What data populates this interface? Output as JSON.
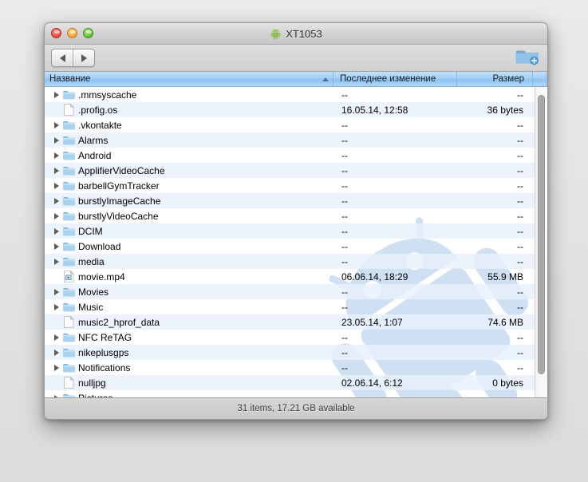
{
  "window": {
    "title": "XT1053",
    "title_icon": "android-robot-icon",
    "controls": {
      "close": "close-button",
      "minimize": "minimize-button",
      "maximize": "maximize-button"
    }
  },
  "toolbar": {
    "back_icon": "triangle-left-icon",
    "forward_icon": "triangle-right-icon",
    "new_folder_icon": "new-folder-icon"
  },
  "columns": {
    "name": "Название",
    "date": "Последнее изменение",
    "size": "Размер",
    "sort_indicator": "sort-ascending-arrow"
  },
  "files": [
    {
      "name": ".mmsyscache",
      "date": "--",
      "size": "--",
      "type": "folder"
    },
    {
      "name": ".profig.os",
      "date": "16.05.14, 12:58",
      "size": "36 bytes",
      "type": "file"
    },
    {
      "name": ".vkontakte",
      "date": "--",
      "size": "--",
      "type": "folder"
    },
    {
      "name": "Alarms",
      "date": "--",
      "size": "--",
      "type": "folder"
    },
    {
      "name": "Android",
      "date": "--",
      "size": "--",
      "type": "folder"
    },
    {
      "name": "ApplifierVideoCache",
      "date": "--",
      "size": "--",
      "type": "folder"
    },
    {
      "name": "barbellGymTracker",
      "date": "--",
      "size": "--",
      "type": "folder"
    },
    {
      "name": "burstlyImageCache",
      "date": "--",
      "size": "--",
      "type": "folder"
    },
    {
      "name": "burstlyVideoCache",
      "date": "--",
      "size": "--",
      "type": "folder"
    },
    {
      "name": "DCIM",
      "date": "--",
      "size": "--",
      "type": "folder"
    },
    {
      "name": "Download",
      "date": "--",
      "size": "--",
      "type": "folder"
    },
    {
      "name": "media",
      "date": "--",
      "size": "--",
      "type": "folder"
    },
    {
      "name": "movie.mp4",
      "date": "06.06.14, 18:29",
      "size": "55.9 MB",
      "type": "media"
    },
    {
      "name": "Movies",
      "date": "--",
      "size": "--",
      "type": "folder"
    },
    {
      "name": "Music",
      "date": "--",
      "size": "--",
      "type": "folder"
    },
    {
      "name": "music2_hprof_data",
      "date": "23.05.14, 1:07",
      "size": "74.6 MB",
      "type": "file"
    },
    {
      "name": "NFC ReTAG",
      "date": "--",
      "size": "--",
      "type": "folder"
    },
    {
      "name": "nikeplusgps",
      "date": "--",
      "size": "--",
      "type": "folder"
    },
    {
      "name": "Notifications",
      "date": "--",
      "size": "--",
      "type": "folder"
    },
    {
      "name": "nulljpg",
      "date": "02.06.14, 6:12",
      "size": "0 bytes",
      "type": "file"
    },
    {
      "name": "Pictures",
      "date": "--",
      "size": "--",
      "type": "folder"
    }
  ],
  "statusbar": {
    "text": "31 items, 17.21 GB available"
  },
  "colors": {
    "header_blue": "#9fcdf6",
    "row_stripe": "#e8f0fb",
    "android_green": "#8cc152",
    "watermark_blue": "#ccdff4"
  }
}
